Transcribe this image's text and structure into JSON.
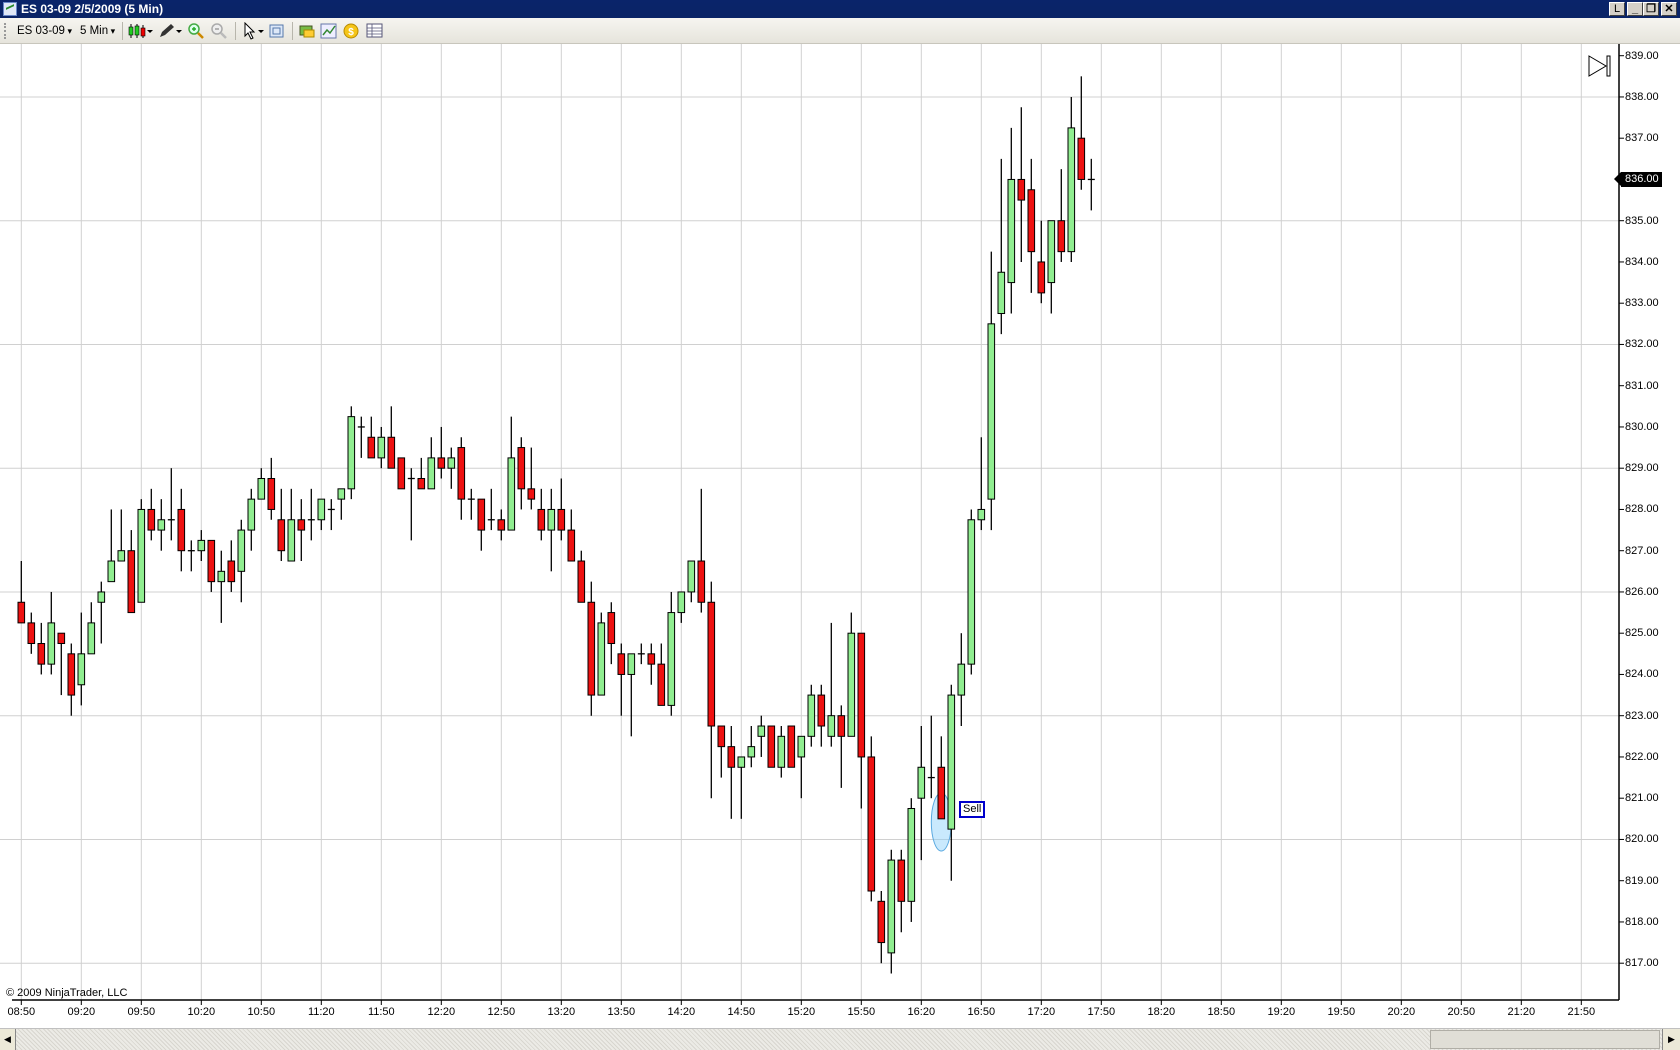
{
  "window": {
    "title": "ES 03-09  2/5/2009 (5 Min)",
    "buttons": {
      "link": "L",
      "minimize": "_",
      "restore": "❐",
      "close": "✕"
    }
  },
  "toolbar": {
    "instrument": "ES 03-09",
    "interval": "5 Min",
    "icons": [
      "chart-style-icon",
      "drawing-pencil-icon",
      "zoom-in-icon",
      "zoom-out-icon",
      "pointer-icon",
      "properties-icon",
      "data-box-icon",
      "indicators-icon",
      "strategies-icon",
      "data-grid-icon"
    ]
  },
  "chart": {
    "copyright": "© 2009 NinjaTrader, LLC",
    "last_price": "836.00",
    "sell_marker": {
      "label": "Sell",
      "bar_index": 92
    },
    "colors": {
      "up": "#90ee90",
      "down": "#ee1111",
      "grid": "#d0d0d0",
      "marker": "#87cefa"
    }
  },
  "chart_data": {
    "type": "candlestick",
    "title": "ES 03-09 2/5/2009 (5 Min)",
    "bar_minutes": 5,
    "first_bar_time": "08:50",
    "ylim": [
      816.5,
      839.2
    ],
    "y_ticks": [
      "839.00",
      "838.00",
      "837.00",
      "836.00",
      "835.00",
      "834.00",
      "833.00",
      "832.00",
      "831.00",
      "830.00",
      "829.00",
      "828.00",
      "827.00",
      "826.00",
      "825.00",
      "824.00",
      "823.00",
      "822.00",
      "821.00",
      "820.00",
      "819.00",
      "818.00",
      "817.00"
    ],
    "y_tick_values": [
      839,
      838,
      837,
      836,
      835,
      834,
      833,
      832,
      831,
      830,
      829,
      828,
      827,
      826,
      825,
      824,
      823,
      822,
      821,
      820,
      819,
      818,
      817
    ],
    "x_ticks": [
      "08:50",
      "09:20",
      "09:50",
      "10:20",
      "10:50",
      "11:20",
      "11:50",
      "12:20",
      "12:50",
      "13:20",
      "13:50",
      "14:20",
      "14:50",
      "15:20",
      "15:50",
      "16:20",
      "16:50",
      "17:20",
      "17:50",
      "18:20",
      "18:50",
      "19:20",
      "19:50",
      "20:20",
      "20:50",
      "21:20",
      "21:50"
    ],
    "grid_price_levels": [
      838,
      835,
      832,
      829,
      826,
      823,
      820,
      817
    ],
    "ohlc_fields": [
      "open",
      "high",
      "low",
      "close"
    ],
    "ohlc": [
      [
        825.75,
        826.75,
        825.25,
        825.25
      ],
      [
        825.25,
        825.5,
        824.5,
        824.75
      ],
      [
        824.75,
        825.25,
        824.0,
        824.25
      ],
      [
        824.25,
        826.0,
        824.0,
        825.25
      ],
      [
        825.0,
        825.0,
        823.5,
        824.75
      ],
      [
        824.5,
        824.75,
        823.0,
        823.5
      ],
      [
        823.75,
        825.5,
        823.25,
        824.5
      ],
      [
        824.5,
        825.75,
        824.5,
        825.25
      ],
      [
        825.75,
        826.25,
        824.75,
        826.0
      ],
      [
        826.25,
        828.0,
        826.25,
        826.75
      ],
      [
        826.75,
        828.0,
        826.75,
        827.0
      ],
      [
        827.0,
        827.5,
        825.5,
        825.5
      ],
      [
        825.75,
        828.25,
        825.75,
        828.0
      ],
      [
        828.0,
        828.5,
        827.25,
        827.5
      ],
      [
        827.5,
        828.25,
        827.0,
        827.75
      ],
      [
        827.75,
        829.0,
        827.25,
        827.75
      ],
      [
        828.0,
        828.5,
        826.5,
        827.0
      ],
      [
        827.0,
        827.25,
        826.5,
        827.0
      ],
      [
        827.0,
        827.5,
        826.75,
        827.25
      ],
      [
        827.25,
        827.25,
        826.0,
        826.25
      ],
      [
        826.25,
        827.0,
        825.25,
        826.5
      ],
      [
        826.75,
        827.25,
        826.0,
        826.25
      ],
      [
        826.5,
        827.75,
        825.75,
        827.5
      ],
      [
        827.5,
        828.5,
        827.0,
        828.25
      ],
      [
        828.25,
        829.0,
        828.25,
        828.75
      ],
      [
        828.75,
        829.25,
        827.75,
        828.0
      ],
      [
        827.75,
        828.5,
        826.75,
        827.0
      ],
      [
        826.75,
        828.5,
        826.75,
        827.75
      ],
      [
        827.75,
        828.25,
        826.75,
        827.5
      ],
      [
        827.75,
        828.5,
        827.25,
        827.75
      ],
      [
        827.75,
        828.25,
        827.5,
        828.25
      ],
      [
        828.0,
        828.25,
        827.5,
        828.0
      ],
      [
        828.25,
        828.5,
        827.75,
        828.5
      ],
      [
        828.5,
        830.5,
        828.25,
        830.25
      ],
      [
        830.0,
        830.25,
        829.25,
        830.0
      ],
      [
        829.75,
        830.25,
        829.25,
        829.25
      ],
      [
        829.25,
        830.0,
        829.0,
        829.75
      ],
      [
        829.75,
        830.5,
        829.0,
        829.0
      ],
      [
        829.25,
        829.25,
        828.5,
        828.5
      ],
      [
        828.75,
        829.0,
        827.25,
        828.75
      ],
      [
        828.75,
        829.25,
        828.5,
        828.5
      ],
      [
        828.5,
        829.75,
        828.5,
        829.25
      ],
      [
        829.25,
        830.0,
        828.75,
        829.0
      ],
      [
        829.0,
        829.5,
        828.5,
        829.25
      ],
      [
        829.5,
        829.75,
        827.75,
        828.25
      ],
      [
        828.25,
        828.5,
        827.75,
        828.25
      ],
      [
        828.25,
        828.25,
        827.0,
        827.5
      ],
      [
        827.75,
        828.5,
        827.5,
        827.75
      ],
      [
        827.75,
        828.0,
        827.25,
        827.5
      ],
      [
        827.5,
        830.25,
        827.5,
        829.25
      ],
      [
        829.5,
        829.75,
        828.0,
        828.5
      ],
      [
        828.5,
        829.5,
        828.0,
        828.25
      ],
      [
        828.0,
        828.5,
        827.25,
        827.5
      ],
      [
        827.5,
        828.5,
        826.5,
        828.0
      ],
      [
        828.0,
        828.75,
        827.25,
        827.5
      ],
      [
        827.5,
        828.0,
        826.75,
        826.75
      ],
      [
        826.75,
        827.0,
        825.75,
        825.75
      ],
      [
        825.75,
        826.25,
        823.0,
        823.5
      ],
      [
        823.5,
        825.5,
        823.5,
        825.25
      ],
      [
        825.5,
        825.75,
        824.25,
        824.75
      ],
      [
        824.5,
        824.75,
        823.0,
        824.0
      ],
      [
        824.0,
        824.5,
        822.5,
        824.5
      ],
      [
        824.5,
        824.75,
        824.25,
        824.5
      ],
      [
        824.5,
        824.75,
        823.75,
        824.25
      ],
      [
        824.25,
        824.75,
        823.25,
        823.25
      ],
      [
        823.25,
        826.0,
        823.0,
        825.5
      ],
      [
        825.5,
        826.0,
        825.25,
        826.0
      ],
      [
        826.0,
        826.75,
        825.75,
        826.75
      ],
      [
        826.75,
        828.5,
        825.5,
        825.75
      ],
      [
        825.75,
        826.25,
        821.0,
        822.75
      ],
      [
        822.75,
        822.75,
        821.5,
        822.25
      ],
      [
        822.25,
        822.75,
        820.5,
        821.75
      ],
      [
        821.75,
        822.0,
        820.5,
        822.0
      ],
      [
        822.0,
        822.75,
        821.75,
        822.25
      ],
      [
        822.5,
        823.0,
        822.0,
        822.75
      ],
      [
        822.75,
        822.75,
        821.75,
        821.75
      ],
      [
        821.75,
        822.75,
        821.5,
        822.5
      ],
      [
        822.75,
        822.75,
        821.75,
        821.75
      ],
      [
        822.0,
        822.5,
        821.0,
        822.5
      ],
      [
        822.5,
        823.75,
        822.25,
        823.5
      ],
      [
        823.5,
        823.75,
        822.25,
        822.75
      ],
      [
        822.5,
        825.25,
        822.25,
        823.0
      ],
      [
        823.0,
        823.25,
        821.25,
        822.5
      ],
      [
        822.5,
        825.5,
        822.5,
        825.0
      ],
      [
        825.0,
        825.0,
        820.75,
        822.0
      ],
      [
        822.0,
        822.5,
        818.5,
        818.75
      ],
      [
        818.5,
        818.75,
        817.0,
        817.5
      ],
      [
        817.25,
        819.75,
        816.75,
        819.5
      ],
      [
        819.5,
        819.75,
        817.75,
        818.5
      ],
      [
        818.5,
        821.0,
        818.0,
        820.75
      ],
      [
        821.0,
        822.75,
        819.5,
        821.75
      ],
      [
        821.5,
        823.0,
        821.0,
        821.5
      ],
      [
        821.75,
        822.5,
        820.5,
        820.5
      ],
      [
        820.25,
        823.75,
        819.0,
        823.5
      ],
      [
        823.5,
        825.0,
        822.75,
        824.25
      ],
      [
        824.25,
        828.0,
        824.0,
        827.75
      ],
      [
        827.75,
        829.75,
        827.5,
        828.0
      ],
      [
        828.25,
        834.25,
        827.5,
        832.5
      ],
      [
        832.75,
        836.5,
        832.25,
        833.75
      ],
      [
        833.5,
        837.25,
        832.75,
        836.0
      ],
      [
        836.0,
        837.75,
        834.0,
        835.5
      ],
      [
        835.75,
        836.5,
        833.25,
        834.25
      ],
      [
        834.0,
        835.0,
        833.0,
        833.25
      ],
      [
        833.5,
        835.0,
        832.75,
        835.0
      ],
      [
        835.0,
        836.25,
        834.0,
        834.25
      ],
      [
        834.25,
        838.0,
        834.0,
        837.25
      ],
      [
        837.0,
        838.5,
        835.75,
        836.0
      ],
      [
        836.0,
        836.5,
        835.25,
        836.0
      ]
    ]
  }
}
